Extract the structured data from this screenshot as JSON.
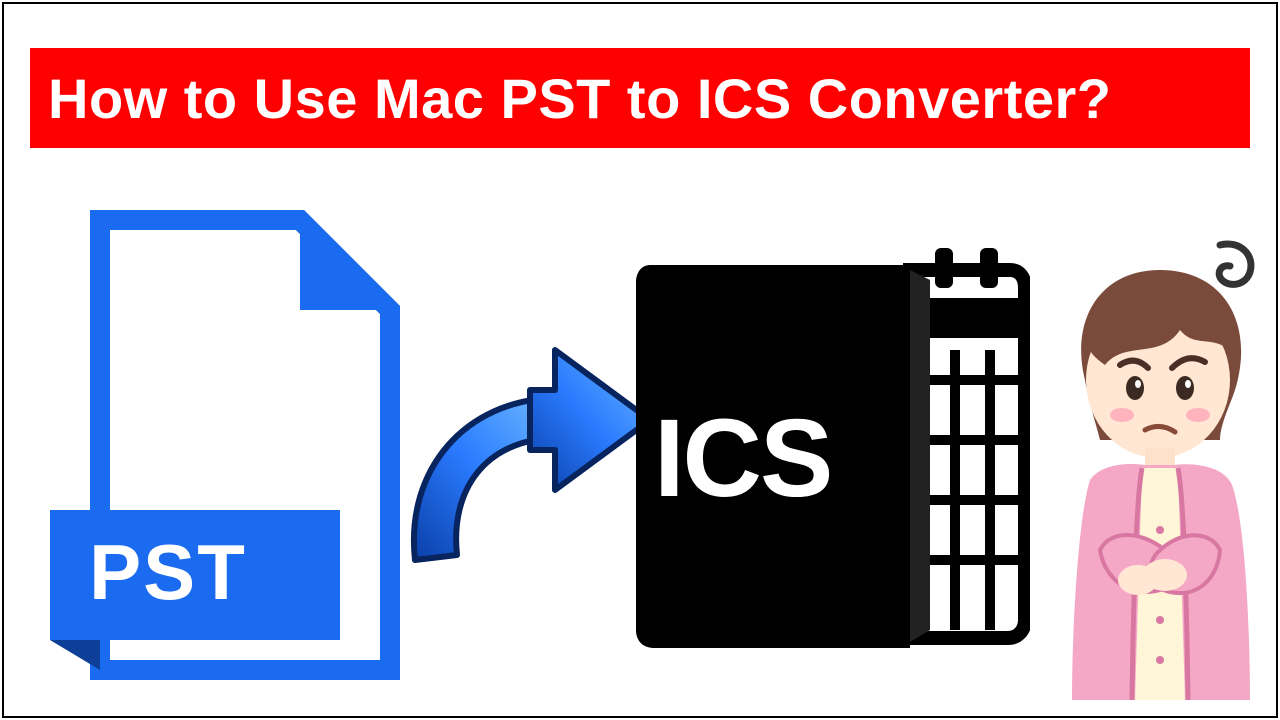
{
  "banner": {
    "title": "How to Use Mac PST to ICS Converter?"
  },
  "icons": {
    "pst_label": "PST",
    "ics_label": "ICS"
  },
  "colors": {
    "banner_bg": "#ff0000",
    "banner_text": "#ffffff",
    "pst_blue": "#1b6bf0",
    "pst_blue_light": "#5aa0ff",
    "arrow_blue": "#1b6bf0",
    "ics_black": "#000000"
  }
}
